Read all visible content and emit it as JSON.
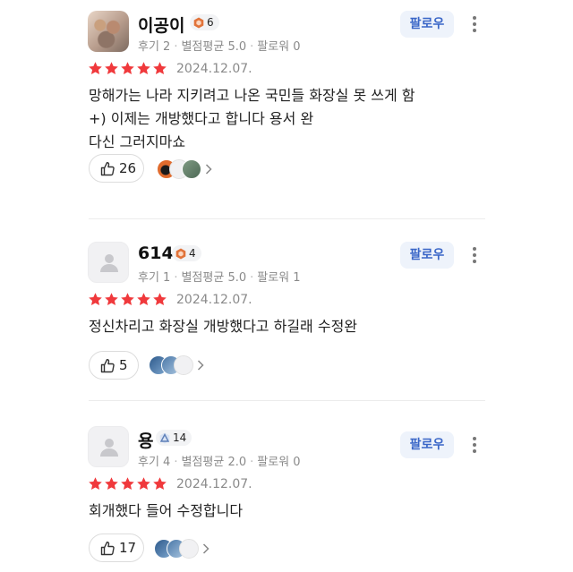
{
  "reviews": [
    {
      "name": "이공이",
      "badge": "6",
      "badge_type": "orange-hexagon-icon",
      "meta": {
        "reviews": "후기 2",
        "rating": "별점평균 5.0",
        "followers": "팔로워 0"
      },
      "follow_label": "팔로우",
      "stars": 5,
      "date": "2024.12.07.",
      "lines": [
        "망해가는 나라 지키려고 나온 국민들 화장실 못 쓰게 함",
        "+) 이제는 개방했다고 합니다 용서 완",
        "다신 그러지마쇼"
      ],
      "likes": "26"
    },
    {
      "name": "614",
      "badge": "4",
      "badge_type": "orange-hexagon-icon",
      "meta": {
        "reviews": "후기 1",
        "rating": "별점평균 5.0",
        "followers": "팔로워 1"
      },
      "follow_label": "팔로우",
      "stars": 5,
      "date": "2024.12.07.",
      "lines": [
        "정신차리고 화장실 개방했다고 하길래 수정완"
      ],
      "likes": "5"
    },
    {
      "name": "용",
      "badge": "14",
      "badge_type": "blue-triangle-icon",
      "meta": {
        "reviews": "후기 4",
        "rating": "별점평균 2.0",
        "followers": "팔로워 0"
      },
      "follow_label": "팔로우",
      "stars": 5,
      "date": "2024.12.07.",
      "lines": [
        "회개했다 들어 수정합니다"
      ],
      "likes": "17"
    }
  ],
  "colors": {
    "star": "#f0393c",
    "follow_bg": "#eef3fb",
    "follow_text": "#3a66c7",
    "meta": "#8a8a8a"
  }
}
